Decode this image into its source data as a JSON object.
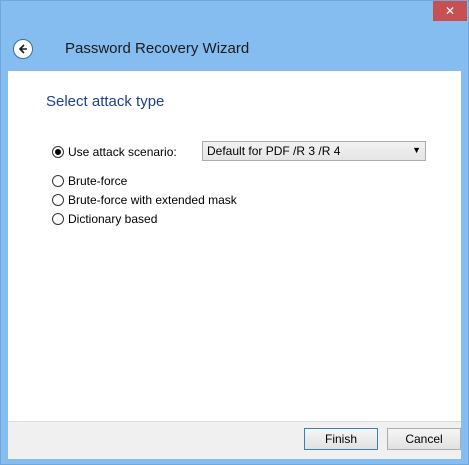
{
  "window": {
    "close_glyph": "✕"
  },
  "header": {
    "title": "Password Recovery Wizard",
    "back_icon": "back-arrow-icon"
  },
  "page": {
    "title": "Select attack type",
    "options": [
      {
        "label": "Use attack scenario:",
        "selected": true
      },
      {
        "label": "Brute-force",
        "selected": false
      },
      {
        "label": "Brute-force with extended mask",
        "selected": false
      },
      {
        "label": "Dictionary based",
        "selected": false
      }
    ],
    "scenario_select": {
      "value": "Default for PDF /R 3 /R 4"
    }
  },
  "footer": {
    "finish_label": "Finish",
    "cancel_label": "Cancel"
  },
  "colors": {
    "accent": "#85bdf0",
    "title_text": "#1e3f8a",
    "close": "#c75050"
  }
}
